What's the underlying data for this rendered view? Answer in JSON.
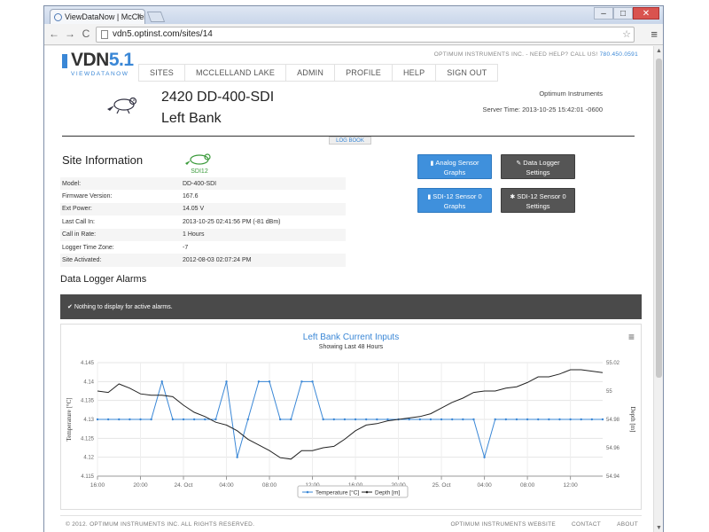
{
  "browser": {
    "tab_title": "ViewDataNow | McClellan",
    "tab_close": "×",
    "url": "vdn5.optinst.com/sites/14",
    "back": "←",
    "forward": "→",
    "reload": "C",
    "star": "☆",
    "menu": "≡",
    "min": "–",
    "max": "□",
    "close": "✕"
  },
  "header": {
    "logo_main": "VDN",
    "logo_version": "5.1",
    "logo_sub": "VIEWDATANOW",
    "support_text": "OPTIMUM INSTRUMENTS INC. - NEED HELP? CALL US!",
    "support_phone": "780.450.0591"
  },
  "nav": {
    "items": [
      "SITES",
      "MCCLELLAND LAKE",
      "ADMIN",
      "PROFILE",
      "HELP",
      "SIGN OUT"
    ]
  },
  "site": {
    "name": "2420 DD-400-SDI",
    "subtitle": "Left Bank",
    "company": "Optimum Instruments",
    "server_time": "Server Time: 2013-10-25 15:42:01 -0600",
    "log_book": "LOG BOOK",
    "sdi_badge": "SDI12"
  },
  "info": {
    "title": "Site Information",
    "rows": [
      {
        "key": "Model:",
        "value": "DD-400-SDI"
      },
      {
        "key": "Firmware Version:",
        "value": "167.6"
      },
      {
        "key": "Ext Power:",
        "value": "14.05 V"
      },
      {
        "key": "Last Call In:",
        "value": "2013-10-25 02:41:56 PM (-81 dBm)"
      },
      {
        "key": "Call in Rate:",
        "value": "1 Hours"
      },
      {
        "key": "Logger Time Zone:",
        "value": "-7"
      },
      {
        "key": "Site Activated:",
        "value": "2012-08-03 02:07:24 PM"
      }
    ]
  },
  "buttons": {
    "analog_line1": "Analog Sensor",
    "analog_line2": "Graphs",
    "logger_line1": "Data Logger",
    "logger_line2": "Settings",
    "sdi_graphs_line1": "SDI-12 Sensor 0",
    "sdi_graphs_line2": "Graphs",
    "sdi_settings_line1": "SDI-12 Sensor 0",
    "sdi_settings_line2": "Settings"
  },
  "alarms": {
    "title": "Data Logger Alarms",
    "message": "Nothing to display for active alarms."
  },
  "chart_data": {
    "type": "line",
    "title": "Left Bank Current Inputs",
    "subtitle": "Showing Last 48 Hours",
    "ylabel_left": "Temperature [°C]",
    "ylabel_right": "Depth [m]",
    "x_tick_labels": [
      "16:00",
      "20:00",
      "24. Oct",
      "04:00",
      "08:00",
      "12:00",
      "16:00",
      "20:00",
      "25. Oct",
      "04:00",
      "08:00",
      "12:00"
    ],
    "x_range": [
      0,
      47
    ],
    "x_unit": "hours",
    "y_left_ticks": [
      "4.115",
      "4.12",
      "4.125",
      "4.13",
      "4.135",
      "4.14",
      "4.145"
    ],
    "y_left_range": [
      4.115,
      4.145
    ],
    "y_right_ticks": [
      "54.94",
      "54.96",
      "54.98",
      "55",
      "55.02"
    ],
    "y_right_range": [
      54.94,
      55.02
    ],
    "grid": true,
    "legend_position": "bottom-center",
    "colors": {
      "temperature": "#3a87d6",
      "depth": "#222222"
    },
    "series": [
      {
        "name": "Temperature [°C]",
        "axis": "left",
        "x": [
          0,
          1,
          2,
          3,
          4,
          5,
          6,
          7,
          8,
          9,
          10,
          11,
          12,
          13,
          14,
          15,
          16,
          17,
          18,
          19,
          20,
          21,
          22,
          23,
          24,
          25,
          26,
          27,
          28,
          29,
          30,
          31,
          32,
          33,
          34,
          35,
          36,
          37,
          38,
          39,
          40,
          41,
          42,
          43,
          44,
          45,
          46,
          47
        ],
        "values": [
          4.13,
          4.13,
          4.13,
          4.13,
          4.13,
          4.13,
          4.14,
          4.13,
          4.13,
          4.13,
          4.13,
          4.13,
          4.14,
          4.12,
          4.13,
          4.14,
          4.14,
          4.13,
          4.13,
          4.14,
          4.14,
          4.13,
          4.13,
          4.13,
          4.13,
          4.13,
          4.13,
          4.13,
          4.13,
          4.13,
          4.13,
          4.13,
          4.13,
          4.13,
          4.13,
          4.13,
          4.12,
          4.13,
          4.13,
          4.13,
          4.13,
          4.13,
          4.13,
          4.13,
          4.13,
          4.13,
          4.13,
          4.13
        ]
      },
      {
        "name": "Depth [m]",
        "axis": "right",
        "x": [
          0,
          1,
          2,
          3,
          4,
          5,
          6,
          7,
          8,
          9,
          10,
          11,
          12,
          13,
          14,
          15,
          16,
          17,
          18,
          19,
          20,
          21,
          22,
          23,
          24,
          25,
          26,
          27,
          28,
          29,
          30,
          31,
          32,
          33,
          34,
          35,
          36,
          37,
          38,
          39,
          40,
          41,
          42,
          43,
          44,
          45,
          46,
          47
        ],
        "values": [
          55.0,
          54.999,
          55.005,
          55.002,
          54.998,
          54.997,
          54.997,
          54.996,
          54.99,
          54.985,
          54.982,
          54.978,
          54.976,
          54.972,
          54.966,
          54.962,
          54.958,
          54.953,
          54.952,
          54.958,
          54.958,
          54.96,
          54.961,
          54.966,
          54.972,
          54.976,
          54.977,
          54.979,
          54.98,
          54.981,
          54.982,
          54.984,
          54.988,
          54.992,
          54.995,
          54.999,
          55.0,
          55.0,
          55.002,
          55.003,
          55.006,
          55.01,
          55.01,
          55.012,
          55.015,
          55.015,
          55.014,
          55.013
        ]
      }
    ]
  },
  "footer": {
    "copyright": "© 2012. OPTIMUM INSTRUMENTS INC. ALL RIGHTS RESERVED.",
    "links": [
      "OPTIMUM INSTRUMENTS WEBSITE",
      "CONTACT",
      "ABOUT"
    ]
  }
}
